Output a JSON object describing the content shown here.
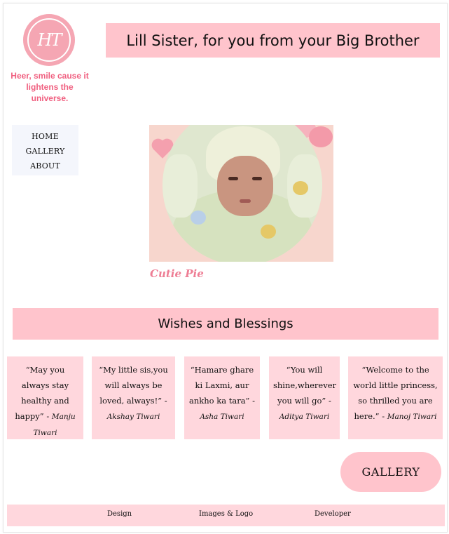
{
  "brand": {
    "logo_text": "HT",
    "tagline": "Heer, smile cause it lightens the universe."
  },
  "header": {
    "title": "Lill Sister, for you from your Big Brother"
  },
  "nav": {
    "items": [
      {
        "label": "HOME"
      },
      {
        "label": "GALLERY"
      },
      {
        "label": "ABOUT"
      }
    ]
  },
  "hero": {
    "caption": "Cutie Pie"
  },
  "wishes": {
    "title": "Wishes and Blessings",
    "cards": [
      {
        "text": "“May you always stay healthy and happy”",
        "author": "Manju Tiwari"
      },
      {
        "text": "“My little sis,you will always be loved, always!”",
        "author": "Akshay Tiwari"
      },
      {
        "text": "“Hamare ghare ki Laxmi, aur ankho ka tara”",
        "author": "Asha Tiwari"
      },
      {
        "text": "“You will shine,wherever you will go”",
        "author": "Aditya Tiwari"
      },
      {
        "text": "“Welcome to the world little princess, so thrilled you are here.”",
        "author": "Manoj Tiwari"
      }
    ]
  },
  "actions": {
    "gallery_label": "GALLERY"
  },
  "footer": {
    "items": [
      {
        "label": "Design"
      },
      {
        "label": "Images & Logo"
      },
      {
        "label": "Developer"
      }
    ]
  },
  "colors": {
    "pink_panel": "#ffc4cc",
    "pink_card": "#ffd7dd",
    "accent_text": "#f06080",
    "logo_bg": "#f5a6b3"
  },
  "icons": {
    "logo": "monogram-logo-icon",
    "decoration": "heart-icon"
  }
}
